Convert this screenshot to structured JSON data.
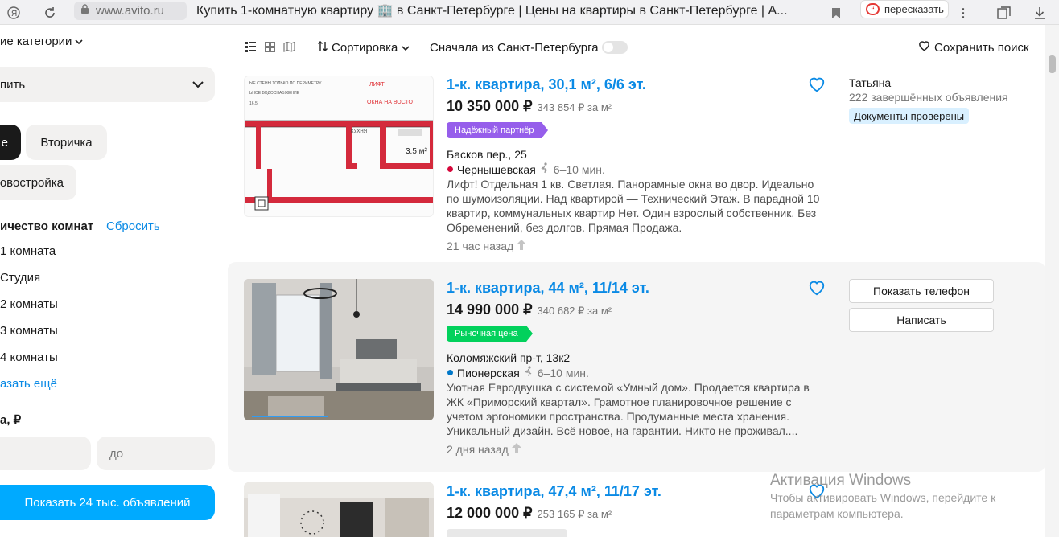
{
  "browser": {
    "url": "www.avito.ru",
    "tab_title": "Купить 1-комнатную квартиру 🏢 в Санкт-Петербурге | Цены на квартиры в Санкт-Петербурге | А...",
    "retell_label": "пересказать"
  },
  "sidebar": {
    "categories_label": "ие категории",
    "deal_select": "пить",
    "type_pills": [
      "е",
      "Вторичка",
      "овостройка"
    ],
    "rooms_title": "ичество комнат",
    "rooms_reset": "Сбросить",
    "rooms": [
      "1 комната",
      "Студия",
      "2 комнаты",
      "3 комнаты",
      "4 комнаты"
    ],
    "show_more": "азать ещё",
    "price_title": "а, ₽",
    "price_to_placeholder": "до",
    "show_button": "Показать 24 тыс. объявлений"
  },
  "toolbar": {
    "sort_label": "Сортировка",
    "spb_first_label": "Сначала из Санкт-Петербурга",
    "save_search_label": "Сохранить поиск"
  },
  "listings": [
    {
      "title": "1-к. квартира, 30,1 м², 6/6 эт.",
      "price": "10 350 000 ₽",
      "price_per_m": "343 854 ₽ за м²",
      "badge": "Надёжный партнёр",
      "address": "Басков пер., 25",
      "metro": "Чернышевская",
      "metro_color": "#d6083b",
      "walk": "6–10 мин.",
      "description": "Лифт! Отдельная 1 кв. Светлая. Панорамные окна во двор. Идеально по шумоизоляции. Над квартирой — Технический Этаж. В парадной 10 квартир, коммунальных квартир Нет. Один взрослый собственник. Без Обременений, без долгов. Прямая Продажа.",
      "time_ago": "21 час назад",
      "plan_labels": [
        "ЛИФТ",
        "ОКНА НА ВОСТО",
        "3.5 м²",
        "КУХНЯ",
        "ЫЕ СТЕНЫ ТОЛЬКО ПО ПЕРИМЕТРУ",
        "ЬНОЕ ВОДОСНАБЖЕНИЕ",
        "16,5"
      ],
      "seller_name": "Татьяна",
      "seller_deals": "222 завершённых объявления",
      "seller_badge": "Документы проверены"
    },
    {
      "title": "1-к. квартира, 44 м², 11/14 эт.",
      "price": "14 990 000 ₽",
      "price_per_m": "340 682 ₽ за м²",
      "badge": "Рыночная цена",
      "address": "Коломяжский пр-т, 13к2",
      "metro": "Пионерская",
      "metro_color": "#0078c9",
      "walk": "6–10 мин.",
      "description": "Уютная Евродвушка с системой «Умный дом». Продается квартира в ЖК «Приморский квартал». Грамотное планировочное решение с учетом эргономики пространства. Продуманные места хранения. Уникальный дизайн. Всё новое, на гарантии. Никто не проживал....",
      "time_ago": "2 дня назад",
      "show_phone": "Показать телефон",
      "write": "Написать"
    },
    {
      "title": "1-к. квартира, 47,4 м², 11/17 эт.",
      "price": "12 000 000 ₽",
      "price_per_m": "253 165 ₽ за м²"
    }
  ],
  "watermark": {
    "title": "Активация Windows",
    "line1": "Чтобы активировать Windows, перейдите к",
    "line2": "параметрам компьютера."
  }
}
